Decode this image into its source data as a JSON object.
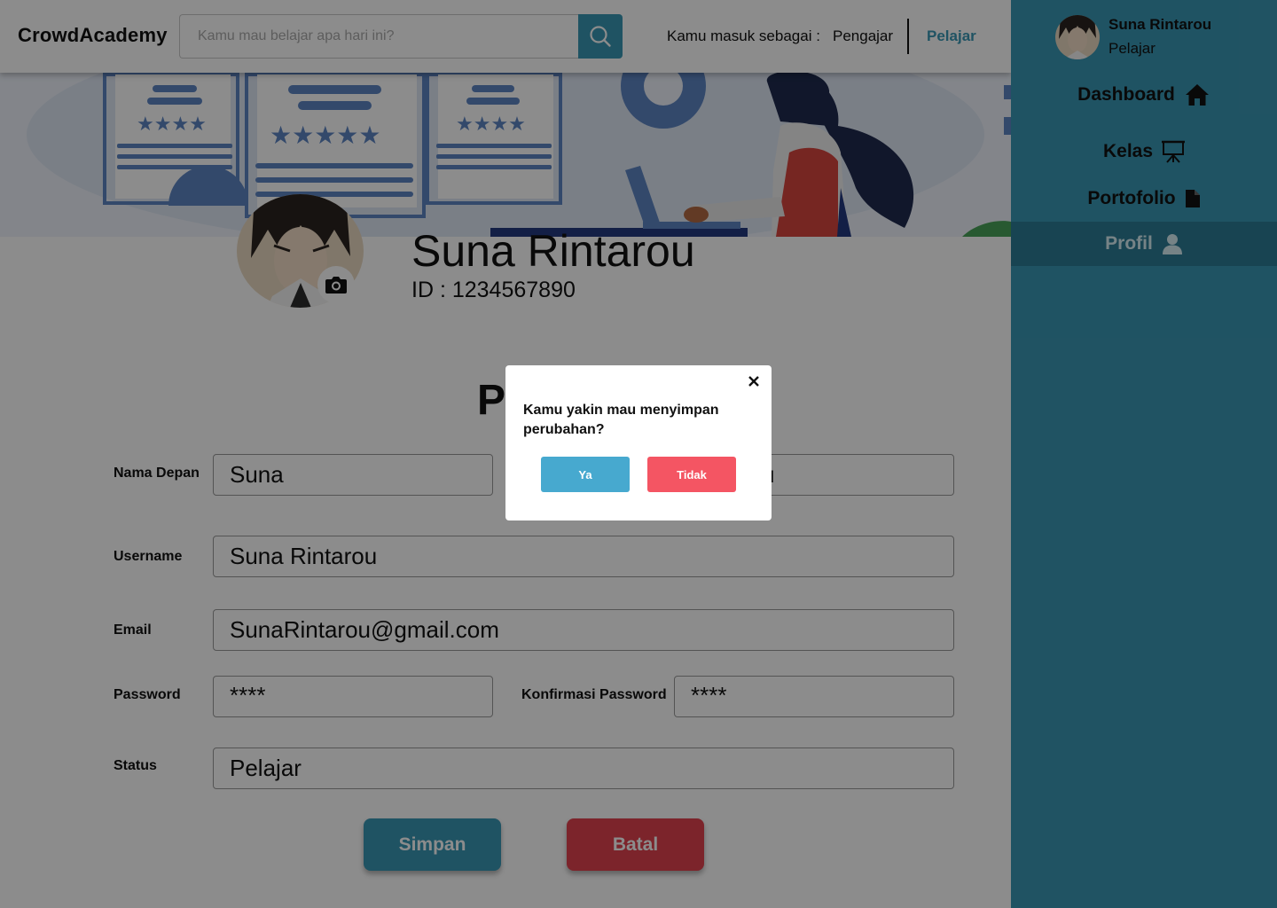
{
  "app": {
    "logo": "CrowdAcademy"
  },
  "search": {
    "placeholder": "Kamu mau belajar apa hari ini?",
    "icon": "search-icon"
  },
  "role_switch": {
    "label": "Kamu masuk sebagai :",
    "teacher": "Pengajar",
    "student": "Pelajar",
    "active": "Pelajar"
  },
  "profile": {
    "name": "Suna Rintarou",
    "id_text": "ID : 1234567890"
  },
  "form": {
    "title_visible": "P",
    "first_name": {
      "label": "Nama Depan",
      "value": "Suna"
    },
    "last_name": {
      "value_visible": "u"
    },
    "username": {
      "label": "Username",
      "value": "Suna Rintarou"
    },
    "email": {
      "label": "Email",
      "value": "SunaRintarou@gmail.com"
    },
    "password": {
      "label": "Password",
      "value": "****"
    },
    "confirm_password": {
      "label": "Konfirmasi Password",
      "value": "****"
    },
    "status": {
      "label": "Status",
      "value": "Pelajar"
    },
    "save_label": "Simpan",
    "cancel_label": "Batal"
  },
  "sidebar": {
    "user_name": "Suna Rintarou",
    "user_role": "Pelajar",
    "items": [
      {
        "label": "Dashboard",
        "icon": "home-icon"
      },
      {
        "label": "Kelas",
        "icon": "presentation-board-icon"
      },
      {
        "label": "Portofolio",
        "icon": "document-icon"
      },
      {
        "label": "Profil",
        "icon": "user-icon",
        "active": true
      }
    ]
  },
  "modal": {
    "message": "Kamu yakin mau menyimpan perubahan?",
    "confirm_label": "Ya",
    "reject_label": "Tidak"
  },
  "colors": {
    "primary": "#3a97b4",
    "danger": "#e2434f",
    "modal_confirm": "#47a9cf",
    "modal_reject": "#f45563",
    "overlay": "rgba(0,0,0,0.45)"
  }
}
